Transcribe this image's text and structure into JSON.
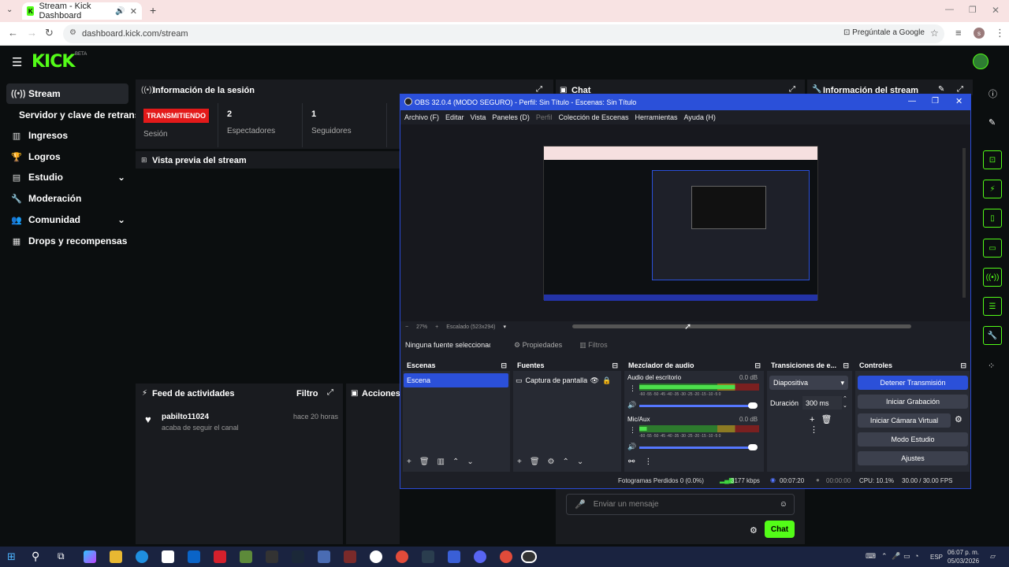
{
  "browser": {
    "tab_title": "Stream - Kick Dashboard",
    "url": "dashboard.kick.com/stream",
    "ask_google": "Pregúntale a Google",
    "new_tab": "+"
  },
  "kick": {
    "logo": "KICK",
    "beta": "BETA",
    "sidebar": [
      {
        "icon": "stream-icon",
        "label": "Stream"
      },
      {
        "icon": "",
        "label": "Servidor y clave de retransm"
      },
      {
        "icon": "chart-icon",
        "label": "Ingresos"
      },
      {
        "icon": "trophy-icon",
        "label": "Logros"
      },
      {
        "icon": "studio-icon",
        "label": "Estudio"
      },
      {
        "icon": "wrench-icon",
        "label": "Moderación"
      },
      {
        "icon": "people-icon",
        "label": "Comunidad"
      },
      {
        "icon": "gift-icon",
        "label": "Drops y recompensas"
      }
    ],
    "session": {
      "title": "Información de la sesión",
      "badge": "TRANSMITIENDO",
      "session_label": "Sesión",
      "viewers_value": "2",
      "viewers_label": "Espectadores",
      "followers_value": "1",
      "followers_label": "Seguidores"
    },
    "preview_title": "Vista previa del stream",
    "chat_title": "Chat",
    "stream_info_title": "Información del stream",
    "feed": {
      "title": "Feed de actividades",
      "filter": "Filtro",
      "user": "pabilto11024",
      "time": "hace 20 horas",
      "action": "acaba de seguir el canal"
    },
    "actions_title": "Acciones d",
    "chat_input_placeholder": "Enviar un mensaje",
    "chat_button": "Chat"
  },
  "obs": {
    "title": "OBS 32.0.4 (MODO SEGURO) - Perfil: Sin Título - Escenas: Sin Título",
    "menu": [
      "Archivo (F)",
      "Editar",
      "Vista",
      "Paneles (D)",
      "Perfil",
      "Colección de Escenas",
      "Herramientas",
      "Ayuda (H)"
    ],
    "zoom": "27%",
    "scale": "Escalado (523x294)",
    "no_source": "Ninguna fuente seleccionad",
    "properties": "Propiedades",
    "filters": "Filtros",
    "scenes_title": "Escenas",
    "scene_item": "Escena",
    "sources_title": "Fuentes",
    "source_item": "Captura de pantalla",
    "mixer_title": "Mezclador de audio",
    "mixer": [
      {
        "name": "Audio del escritorio",
        "db": "0.0 dB"
      },
      {
        "name": "Mic/Aux",
        "db": "0.0 dB"
      }
    ],
    "meter_scale": "-60 -55 -50 -45 -40 -35 -30 -25 -20 -15 -10 -5 0",
    "transitions_title": "Transiciones de e...",
    "transition": "Diapositiva",
    "duration_label": "Duración",
    "duration_value": "300 ms",
    "controls_title": "Controles",
    "controls": [
      "Detener Transmisión",
      "Iniciar Grabación",
      "Iniciar Cámara Virtual",
      "Modo Estudio",
      "Ajustes"
    ],
    "status": {
      "dropped": "Fotogramas Perdidos 0 (0.0%)",
      "bitrate": "3177 kbps",
      "stream_time": "00:07:20",
      "rec_time": "00:00:00",
      "cpu": "CPU: 10.1%",
      "fps": "30.00 / 30.00 FPS"
    }
  },
  "taskbar": {
    "lang": "ESP",
    "time": "06:07 p. m.",
    "date": "05/03/2026"
  },
  "colors": {
    "kick_green": "#53fc18",
    "obs_blue": "#2b50d9",
    "live_red": "#e31a1a"
  }
}
